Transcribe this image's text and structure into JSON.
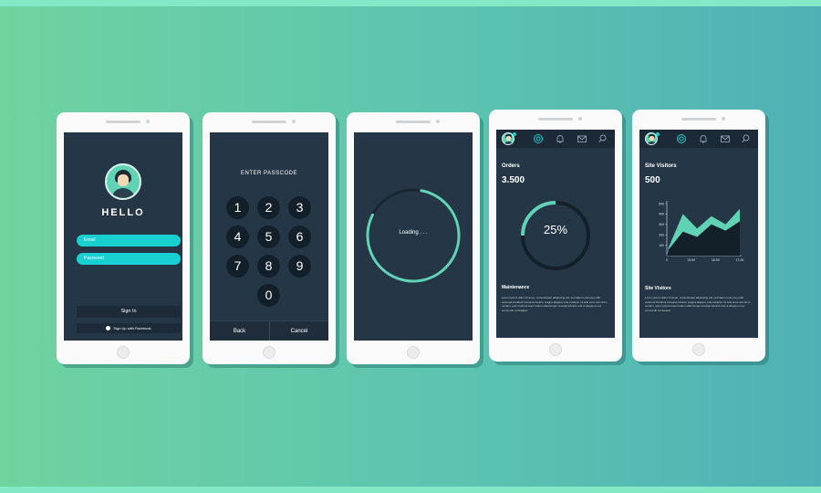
{
  "colors": {
    "screen_bg": "#253746",
    "accent_cyan": "#18d0d0",
    "accent_mint": "#62d2b4",
    "dark_button": "#1c2b37",
    "key_bg": "#142029"
  },
  "login_screen": {
    "title": "HELLO",
    "email_placeholder": "Email",
    "password_placeholder": "Password",
    "sign_in_label": "Sign In",
    "facebook_label": "Sign Up with Facebook",
    "facebook_icon": "facebook-icon"
  },
  "passcode_screen": {
    "title": "ENTER PASSCODE",
    "keys": [
      "1",
      "2",
      "3",
      "4",
      "5",
      "6",
      "7",
      "8",
      "9",
      "0"
    ],
    "back_label": "Back",
    "cancel_label": "Cancel"
  },
  "loading_screen": {
    "text": "Loading . . ."
  },
  "orders_screen": {
    "nav_icons": [
      "avatar",
      "settings-icon",
      "bell-icon",
      "mail-icon",
      "search-icon"
    ],
    "section_label": "Orders",
    "value": "3.500",
    "progress_percent_label": "25%",
    "progress_fraction": 0.25,
    "maintenance_label": "Maintenance",
    "body_text": "Lorem ipsum dolor sit amet, consectetuer adipiscing elit, sed diam nonummy nibh euismod tincidunt ut laoreet dolore magna aliquam erat volutpat. Ut wisi enim ad minim veniam, quis nostrud exerci tation ullamcorper suscipit lobortis nisl ut aliquip ex ea commodo consequat."
  },
  "visitors_screen": {
    "nav_icons": [
      "avatar",
      "settings-icon",
      "bell-icon",
      "mail-icon",
      "search-icon"
    ],
    "section_label": "Site Visitors",
    "value": "500",
    "section_label_2": "Site Visitors",
    "body_text": "Lorem ipsum dolor sit amet, consectetuer adipiscing elit, sed diam nonummy nibh euismod tincidunt ut laoreet dolore magna aliquam erat volutpat. Ut wisi enim ad minim veniam, quis nostrud exerci tation ullamcorper suscipit lobortis nisl ut aliquip ex ea commodo consequat."
  },
  "chart_data": {
    "type": "area",
    "x": [
      "0",
      "15.00",
      "16.00",
      "17.00"
    ],
    "yticks": [
      "500",
      "400",
      "300",
      "200",
      "100",
      "0"
    ],
    "ylim": [
      0,
      500
    ],
    "series": [
      {
        "color": "#62d2b4",
        "values": [
          80,
          400,
          260,
          380,
          300,
          450
        ]
      },
      {
        "color": "#142029",
        "values": [
          60,
          230,
          180,
          300,
          240,
          330
        ]
      }
    ]
  }
}
